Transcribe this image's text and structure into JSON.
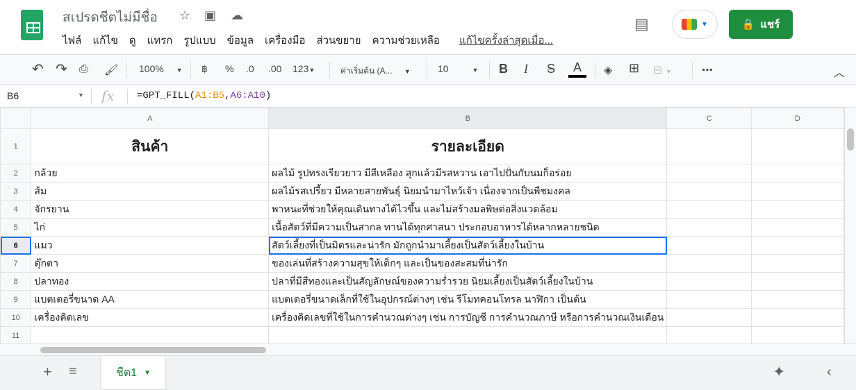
{
  "header": {
    "title": "สเปรดชีตไม่มีชื่อ",
    "menu": [
      "ไฟล์",
      "แก้ไข",
      "ดู",
      "แทรก",
      "รูปแบบ",
      "ข้อมูล",
      "เครื่องมือ",
      "ส่วนขยาย",
      "ความช่วยเหลือ"
    ],
    "last_edit": "แก้ไขครั้งล่าสุดเมื่อ...",
    "share_label": "แชร์"
  },
  "toolbar": {
    "zoom": "100%",
    "currency": "฿",
    "percent": "%",
    "dec_less": ".0",
    "dec_more": ".00",
    "format": "123",
    "font": "ค่าเริ่มต้น (A...",
    "size": "10",
    "bold": "B",
    "italic": "I",
    "strike": "S",
    "color": "A"
  },
  "formula_bar": {
    "cell_ref": "B6",
    "fx": "fx",
    "formula_prefix": "=GPT_FILL(",
    "range1": "A1:B5",
    "comma": ",",
    "range2": "A6:A10",
    "formula_suffix": ")"
  },
  "columns": [
    "A",
    "B",
    "C",
    "D"
  ],
  "rows": [
    {
      "n": "1",
      "a": "สินค้า",
      "b": "รายละเอียด"
    },
    {
      "n": "2",
      "a": "กล้วย",
      "b": "ผลไม้ รูปทรงเรียวยาว มีสีเหลือง สุกแล้วมีรสหวาน เอาไปปั่นกับนมก็อร่อย"
    },
    {
      "n": "3",
      "a": "ส้ม",
      "b": "ผลไม้รสเปรี้ยว มีหลายสายพันธุ์ นิยมนำมาไหว้เจ้า เนื่องจากเป็นพืชมงคล"
    },
    {
      "n": "4",
      "a": "จักรยาน",
      "b": "พาหนะที่ช่วยให้คุณเดินทางได้ไวขึ้น และไม่สร้างมลพิษต่อสิ่งแวดล้อม"
    },
    {
      "n": "5",
      "a": "ไก่",
      "b": "เนื้อสัตว์ที่มีความเป็นสากล ทานได้ทุกศาสนา ประกอบอาหารได้หลากหลายชนิด"
    },
    {
      "n": "6",
      "a": "แมว",
      "b": "สัตว์เลี้ยงที่เป็นมิตรและน่ารัก มักถูกนำมาเลี้ยงเป็นสัตว์เลี้ยงในบ้าน"
    },
    {
      "n": "7",
      "a": "ตุ๊กตา",
      "b": "ของเล่นที่สร้างความสุขให้เด็กๆ และเป็นของสะสมที่น่ารัก"
    },
    {
      "n": "8",
      "a": "ปลาทอง",
      "b": "ปลาที่มีสีทองและเป็นสัญลักษณ์ของความร่ำรวย นิยมเลี้ยงเป็นสัตว์เลี้ยงในบ้าน"
    },
    {
      "n": "9",
      "a": "แบตเตอรี่ขนาด AA",
      "b": "แบตเตอรี่ขนาดเล็กที่ใช้ในอุปกรณ์ต่างๆ เช่น รีโมทคอนโทรล นาฬิกา เป็นต้น"
    },
    {
      "n": "10",
      "a": "เครื่องคิดเลข",
      "b": "เครื่องคิดเลขที่ใช้ในการคำนวณต่างๆ เช่น การบัญชี การคำนวณภาษี หรือการคำนวณเงินเดือน"
    },
    {
      "n": "11",
      "a": "",
      "b": ""
    }
  ],
  "sheet": {
    "tab_label": "ชีต1"
  }
}
